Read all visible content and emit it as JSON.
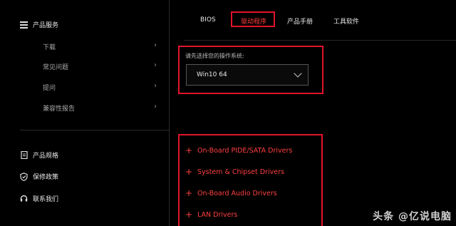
{
  "sidebar": {
    "header": "产品服务",
    "sub_items": [
      "下载",
      "常见问题",
      "提问",
      "兼容性报告"
    ],
    "bottom_items": [
      {
        "label": "产品规格",
        "icon": "doc-icon"
      },
      {
        "label": "保修政策",
        "icon": "shield-check-icon"
      },
      {
        "label": "联系我们",
        "icon": "headset-icon"
      }
    ]
  },
  "tabs": [
    "BIOS",
    "驱动程序",
    "产品手册",
    "工具软件"
  ],
  "active_tab": "驱动程序",
  "os": {
    "label": "请先选择您的操作系统:",
    "selected": "Win10 64"
  },
  "drivers": [
    "On-Board PIDE/SATA Drivers",
    "System & Chipset Drivers",
    "On-Board Audio Drivers",
    "LAN Drivers"
  ],
  "watermark": "头条 @亿说电脑",
  "colors": {
    "accent": "#e0142a",
    "driver_text": "#ff4040",
    "background": "#000000"
  }
}
